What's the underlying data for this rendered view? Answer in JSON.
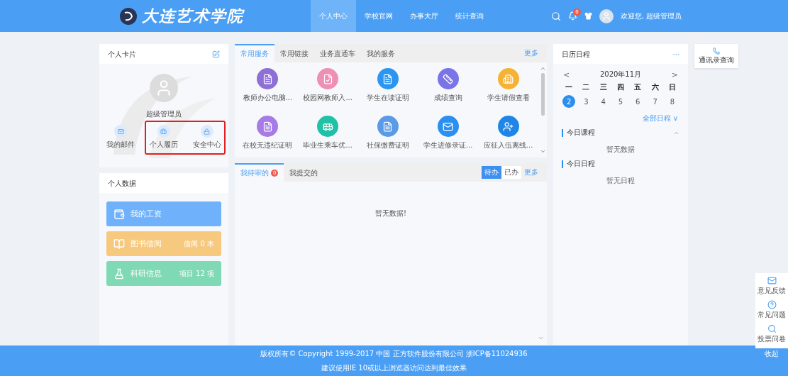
{
  "header": {
    "logo_text": "大连艺术学院",
    "nav": [
      {
        "label": "个人中心",
        "selected": true
      },
      {
        "label": "学校官网",
        "selected": false
      },
      {
        "label": "办事大厅",
        "selected": false
      },
      {
        "label": "统计查询",
        "selected": false
      }
    ],
    "notification_badge": "0",
    "greeting": "欢迎您, 超级管理员"
  },
  "profile_card": {
    "title": "个人卡片",
    "name": "超级管理员",
    "actions": [
      {
        "label": "我的邮件"
      },
      {
        "label": "个人履历"
      },
      {
        "label": "安全中心"
      }
    ]
  },
  "personal_data": {
    "title": "个人数据",
    "items": [
      {
        "label": "我的工资",
        "color": "#6fb1fb"
      },
      {
        "label": "图书借阅",
        "value": "借阅 0 本",
        "color": "#f7c97e"
      },
      {
        "label": "科研信息",
        "value": "项目 12 项",
        "color": "#7ed9b4"
      }
    ]
  },
  "services": {
    "tabs": [
      {
        "label": "常用服务",
        "selected": true
      },
      {
        "label": "常用链接",
        "selected": false
      },
      {
        "label": "业务直通车",
        "selected": false
      },
      {
        "label": "我的服务",
        "selected": false
      }
    ],
    "more": "更多",
    "items": [
      {
        "label": "教师办公电脑...",
        "color": "#8d6fd6"
      },
      {
        "label": "校园网教师入...",
        "color": "#ef8fb4"
      },
      {
        "label": "学生在读证明",
        "color": "#2b95f0"
      },
      {
        "label": "成绩查询",
        "color": "#7a74e8"
      },
      {
        "label": "学生请假查看",
        "color": "#f5b234"
      },
      {
        "label": "在校无违纪证明",
        "color": "#a77be6"
      },
      {
        "label": "毕业生乘车优...",
        "color": "#1fc2a6"
      },
      {
        "label": "社保缴费证明",
        "color": "#5a9ae6"
      },
      {
        "label": "学生进修录证...",
        "color": "#2b8ff0"
      },
      {
        "label": "应征入伍离线...",
        "color": "#1f86e8"
      }
    ]
  },
  "tasks": {
    "tabs": [
      {
        "label": "我待审的",
        "badge": "0",
        "selected": true
      },
      {
        "label": "我提交的",
        "selected": false
      }
    ],
    "filters": [
      {
        "label": "待办",
        "selected": true
      },
      {
        "label": "已办",
        "selected": false
      }
    ],
    "more": "更多",
    "empty": "暂无数据!"
  },
  "calendar": {
    "title": "日历日程",
    "menu": "···",
    "prev": "<",
    "next": ">",
    "month": "2020年11月",
    "weekdays": [
      "一",
      "二",
      "三",
      "四",
      "五",
      "六",
      "日"
    ],
    "days": [
      {
        "label": "2",
        "selected": true
      },
      {
        "label": "3",
        "selected": false
      },
      {
        "label": "4",
        "selected": false
      },
      {
        "label": "5",
        "selected": false
      },
      {
        "label": "6",
        "selected": false
      },
      {
        "label": "7",
        "selected": false
      },
      {
        "label": "8",
        "selected": false
      }
    ],
    "all_link": "全部日程 ∨",
    "sections": [
      {
        "title": "今日课程",
        "empty": "暂无数据"
      },
      {
        "title": "今日日程",
        "empty": "暂无日程"
      }
    ]
  },
  "contact_card": {
    "label": "通讯录查询"
  },
  "float_tools": [
    {
      "label": "意见反馈"
    },
    {
      "label": "常见问题"
    },
    {
      "label": "投票问卷"
    }
  ],
  "collapse": "收起",
  "footer": {
    "copyright": "版权所有© Copyright 1999-2017 中国 正方软件股份有限公司 浙ICP备11024936",
    "hint": "建议使用IE 10或以上浏览器访问达到最佳效果"
  }
}
